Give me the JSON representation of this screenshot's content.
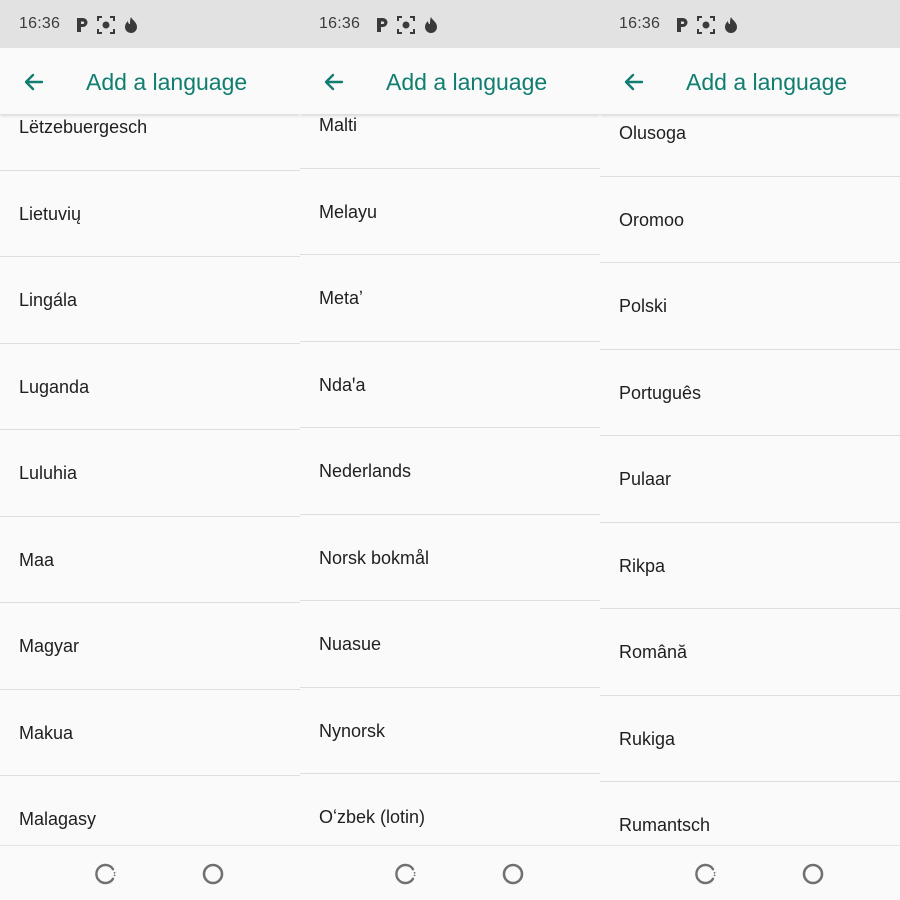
{
  "screens": [
    {
      "status": {
        "time": "16:36",
        "icons": [
          "p-app-icon",
          "screenshot-icon",
          "fire-icon"
        ]
      },
      "app_bar": {
        "back_icon": "arrow-left-icon",
        "title": "Add a language"
      },
      "languages": [
        "Lëtzebuergesch",
        "Lietuvių",
        "Lingála",
        "Luganda",
        "Luluhia",
        "Maa",
        "Magyar",
        "Makua",
        "Malagasy"
      ],
      "nav": {
        "recents_icon": "recents-spinner-icon",
        "home_icon": "home-circle-icon"
      }
    },
    {
      "status": {
        "time": "16:36",
        "icons": [
          "p-app-icon",
          "screenshot-icon",
          "fire-icon"
        ]
      },
      "app_bar": {
        "back_icon": "arrow-left-icon",
        "title": "Add a language"
      },
      "languages": [
        "Malti",
        "Melayu",
        "Metaʼ",
        "Ndaꞌa",
        "Nederlands",
        "Norsk bokmål",
        "Nuasue",
        "Nynorsk",
        "Oʻzbek (lotin)"
      ],
      "nav": {
        "recents_icon": "recents-spinner-icon",
        "home_icon": "home-circle-icon"
      }
    },
    {
      "status": {
        "time": "16:36",
        "icons": [
          "p-app-icon",
          "screenshot-icon",
          "fire-icon"
        ]
      },
      "app_bar": {
        "back_icon": "arrow-left-icon",
        "title": "Add a language"
      },
      "languages": [
        "Olusoga",
        "Oromoo",
        "Polski",
        "Português",
        "Pulaar",
        "Rikpa",
        "Română",
        "Rukiga",
        "Rumantsch"
      ],
      "nav": {
        "recents_icon": "recents-spinner-icon",
        "home_icon": "home-circle-icon"
      }
    }
  ],
  "colors": {
    "accent": "#0f7d6f",
    "status_bar_bg": "#e2e2e2",
    "list_bg": "#fafafa",
    "divider": "#dedede",
    "text_primary": "#1f1f1f"
  }
}
